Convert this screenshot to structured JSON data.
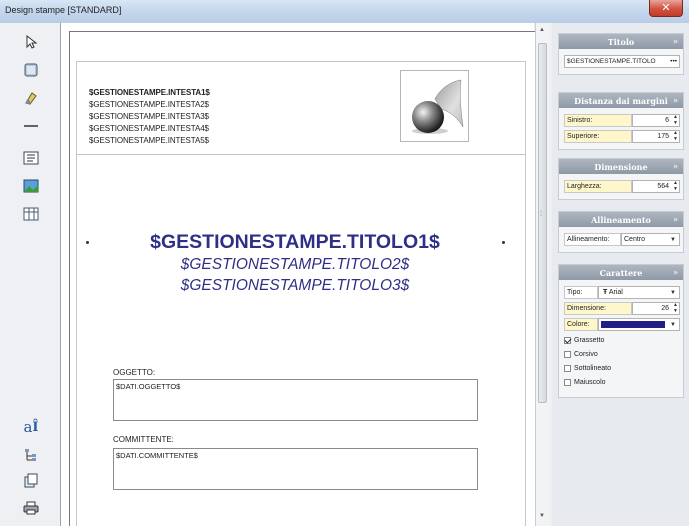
{
  "window": {
    "title": "Design stampe [STANDARD]"
  },
  "toolbox": {
    "items": [
      {
        "icon": "pointer-icon"
      },
      {
        "icon": "rectangle-icon"
      },
      {
        "icon": "image-icon"
      },
      {
        "icon": "line-icon"
      },
      {
        "icon": "text-field-icon"
      },
      {
        "icon": "picture-icon"
      },
      {
        "icon": "table-icon"
      },
      {
        "icon": "font-icon"
      },
      {
        "icon": "tree-icon"
      },
      {
        "icon": "copy-icon"
      },
      {
        "icon": "print-icon"
      }
    ]
  },
  "report": {
    "header_lines": [
      "$GESTIONESTAMPE.INTESTA1$",
      "$GESTIONESTAMPE.INTESTA2$",
      "$GESTIONESTAMPE.INTESTA3$",
      "$GESTIONESTAMPE.INTESTA4$",
      "$GESTIONESTAMPE.INTESTA5$"
    ],
    "title1": "$GESTIONESTAMPE.TITOLO1$",
    "title2": "$GESTIONESTAMPE.TITOLO2$",
    "title3": "$GESTIONESTAMPE.TITOLO3$",
    "fields": [
      {
        "label": "OGGETTO:",
        "value": "$DATI.OGGETTO$"
      },
      {
        "label": "COMMITTENTE:",
        "value": "$DATI.COMMITTENTE$"
      }
    ]
  },
  "panel": {
    "titolo": {
      "header": "Titolo",
      "value": "$GESTIONESTAMPE.TITOLO",
      "ellipsis": "•••"
    },
    "margini": {
      "header": "Distanza dai margini",
      "sinistro_label": "Sinistro:",
      "sinistro_value": "6",
      "superiore_label": "Superiore:",
      "superiore_value": "175"
    },
    "dimensione": {
      "header": "Dimensione",
      "larghezza_label": "Larghezza:",
      "larghezza_value": "564"
    },
    "allineamento": {
      "header": "Allineamento",
      "label": "Allineamento:",
      "value": "Centro"
    },
    "carattere": {
      "header": "Carattere",
      "tipo_label": "Tipo:",
      "tipo_value": "Arial",
      "dimensione_label": "Dimensione:",
      "dimensione_value": "26",
      "colore_label": "Colore:",
      "colore_value": "#1f1f86",
      "options": [
        {
          "label": "Grassetto",
          "checked": true
        },
        {
          "label": "Corsivo",
          "checked": false
        },
        {
          "label": "Sottolineato",
          "checked": false
        },
        {
          "label": "Maiuscolo",
          "checked": false
        }
      ]
    },
    "collapse_glyph": "»"
  },
  "colors": {
    "title_text": "#2e2f86",
    "panel_header": "#98a2ae",
    "label_bg": "#fff7cc",
    "close_button": "#c94a36"
  }
}
